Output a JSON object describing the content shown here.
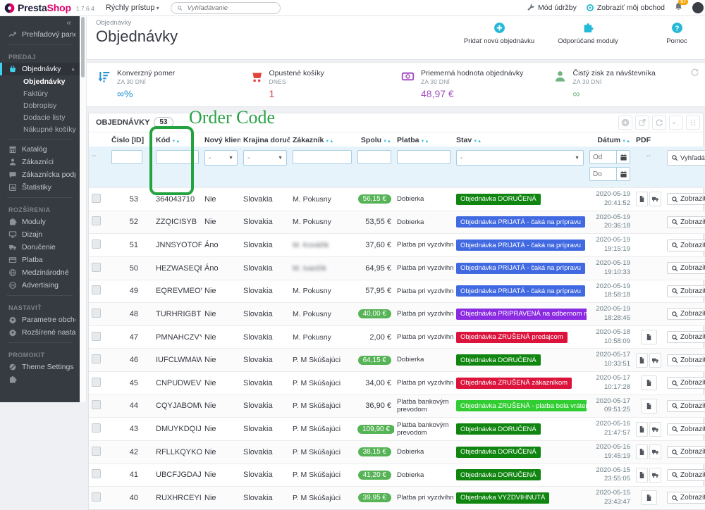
{
  "accent_color": "#25b9d7",
  "topbar": {
    "brand_presta": "Presta",
    "brand_shop": "Shop",
    "version": "1.7.6.4",
    "quick_access": "Rýchly prístup",
    "search_placeholder": "Vyhľadávanie",
    "maintenance_label": "Mód údržby",
    "view_shop_label": "Zobraziť môj obchod",
    "notifications_count": "57"
  },
  "sidebar": {
    "collapse_glyph": "«",
    "sections": [
      {
        "header": "",
        "items": [
          {
            "icon": "trend",
            "label": "Prehľadový panel"
          }
        ]
      },
      {
        "header": "PREDAJ",
        "items": [
          {
            "icon": "basket",
            "label": "Objednávky",
            "active": true,
            "expanded": true,
            "submenu": [
              {
                "label": "Objednávky",
                "active": true
              },
              {
                "label": "Faktúry"
              },
              {
                "label": "Dobropisy"
              },
              {
                "label": "Dodacie listy"
              },
              {
                "label": "Nákupné košíky"
              }
            ]
          },
          {
            "icon": "store",
            "label": "Katalóg"
          },
          {
            "icon": "person",
            "label": "Zákazníci"
          },
          {
            "icon": "chat",
            "label": "Zákaznícka podpora"
          },
          {
            "icon": "stats",
            "label": "Štatistiky"
          }
        ]
      },
      {
        "header": "ROZŠÍRENIA",
        "items": [
          {
            "icon": "puzzle",
            "label": "Moduly"
          },
          {
            "icon": "monitor",
            "label": "Dizajn"
          },
          {
            "icon": "truck",
            "label": "Doručenie"
          },
          {
            "icon": "card",
            "label": "Platba"
          },
          {
            "icon": "globe",
            "label": "Medzinárodné"
          },
          {
            "icon": "ball",
            "label": "Advertising"
          }
        ]
      },
      {
        "header": "NASTAVIŤ",
        "items": [
          {
            "icon": "gear",
            "label": "Parametre obchodu"
          },
          {
            "icon": "gear",
            "label": "Rozšírené nastavenia"
          }
        ]
      },
      {
        "header": "PROMOKIT",
        "items": [
          {
            "icon": "theme",
            "label": "Theme Settings"
          },
          {
            "icon": "puzzle",
            "label": ""
          }
        ]
      }
    ]
  },
  "header": {
    "breadcrumb": "Objednávky",
    "title": "Objednávky",
    "actions": [
      {
        "icon": "plus-circle",
        "label": "Pridať novú objednávku"
      },
      {
        "icon": "puzzle-blue",
        "label": "Odporúčané moduly"
      },
      {
        "icon": "question-circle",
        "label": "Pomoc"
      }
    ]
  },
  "kpis": [
    {
      "icon": "funnel",
      "icon_color": "#2592d0",
      "label": "Konverzný pomer",
      "sublabel": "ZA 30 DNÍ",
      "value": "∞%",
      "value_color": "#2592d0"
    },
    {
      "icon": "cart",
      "icon_color": "#e0433b",
      "label": "Opustené košíky",
      "sublabel": "DNES",
      "value": "1",
      "value_color": "#e0433b"
    },
    {
      "icon": "banknote",
      "icon_color": "#a34fc3",
      "label": "Priemerná hodnota objednávky",
      "sublabel": "ZA 30 DNÍ",
      "value": "48,97 €",
      "value_color": "#a34fc3"
    },
    {
      "icon": "person",
      "icon_color": "#70b580",
      "label": "Čistý zisk za návštevníka",
      "sublabel": "ZA 30 DNÍ",
      "value": "∞",
      "value_color": "#70b580"
    }
  ],
  "panel": {
    "title": "OBJEDNÁVKY",
    "count": "53",
    "tools": [
      "plus-circle",
      "export",
      "refresh",
      "terminal",
      "grid"
    ]
  },
  "table": {
    "columns": [
      {
        "key": "check",
        "label": "",
        "sortable": false
      },
      {
        "key": "id",
        "label": "Čislo [ID]",
        "sortable": true,
        "align": "right"
      },
      {
        "key": "code",
        "label": "Kód",
        "sortable": true
      },
      {
        "key": "new_client",
        "label": "Nový klient",
        "sortable": false
      },
      {
        "key": "country",
        "label": "Krajina doručenia",
        "sortable": true
      },
      {
        "key": "customer",
        "label": "Zákazník",
        "sortable": true
      },
      {
        "key": "total",
        "label": "Spolu",
        "sortable": true,
        "align": "right"
      },
      {
        "key": "payment",
        "label": "Platba",
        "sortable": true
      },
      {
        "key": "status",
        "label": "Stav",
        "sortable": true
      },
      {
        "key": "date",
        "label": "Dátum",
        "sortable": true,
        "align": "right"
      },
      {
        "key": "pdf",
        "label": "PDF",
        "sortable": false
      },
      {
        "key": "actions",
        "label": "",
        "sortable": false
      }
    ],
    "filters": {
      "dash": "--",
      "select_value": "-",
      "date_from_placeholder": "Od",
      "date_to_placeholder": "Do",
      "search_label": "Vyhľadávanie"
    },
    "row_action_label": "Zobraziť",
    "rows": [
      {
        "id": "53",
        "code": "364043710",
        "new_client": "Nie",
        "country": "Slovakia",
        "customer": "M. Pokusny",
        "total": "56,15 €",
        "total_pill": true,
        "payment": "Dobierka",
        "status": "Objednávka DORUČENÁ",
        "status_color": "#108510",
        "date": "2020-05-19",
        "time": "20:41:52",
        "pdf": [
          "invoice",
          "delivery"
        ]
      },
      {
        "id": "52",
        "code": "ZZQICISYB",
        "new_client": "Nie",
        "country": "Slovakia",
        "customer": "M. Pokusny",
        "total": "53,55 €",
        "total_pill": false,
        "payment": "Dobierka",
        "status": "Objednávka PRIJATÁ - čaká na prípravu",
        "status_color": "#4169e1",
        "date": "2020-05-19",
        "time": "20:36:18",
        "pdf": []
      },
      {
        "id": "51",
        "code": "JNNSYOTOF",
        "new_client": "Áno",
        "country": "Slovakia",
        "customer": "M. Kováčik",
        "customer_blurred": true,
        "total": "37,60 €",
        "total_pill": false,
        "payment": "Platba pri vyzdvihnutí",
        "status": "Objednávka PRIJATÁ - čaká na prípravu",
        "status_color": "#4169e1",
        "date": "2020-05-19",
        "time": "19:15:19",
        "pdf": []
      },
      {
        "id": "50",
        "code": "HEZWASEQB",
        "new_client": "Áno",
        "country": "Slovakia",
        "customer": "M. Ivančík",
        "customer_blurred": true,
        "total": "64,95 €",
        "total_pill": false,
        "payment": "Platba pri vyzdvihnutí",
        "status": "Objednávka PRIJATÁ - čaká na prípravu",
        "status_color": "#4169e1",
        "date": "2020-05-19",
        "time": "19:10:33",
        "pdf": []
      },
      {
        "id": "49",
        "code": "EQREVMEOW",
        "new_client": "Nie",
        "country": "Slovakia",
        "customer": "M. Pokusny",
        "total": "57,95 €",
        "total_pill": false,
        "payment": "Platba pri vyzdvihnutí",
        "status": "Objednávka PRIJATÁ - čaká na prípravu",
        "status_color": "#4169e1",
        "date": "2020-05-19",
        "time": "18:58:18",
        "pdf": []
      },
      {
        "id": "48",
        "code": "TURHRIGBT",
        "new_client": "Nie",
        "country": "Slovakia",
        "customer": "M. Pokusny",
        "total": "40,00 €",
        "total_pill": true,
        "payment": "Platba pri vyzdvihnutí",
        "status": "Objednávka PRIPRAVENÁ na odbernom mieste",
        "status_color": "#8a2be2",
        "date": "2020-05-19",
        "time": "18:28:45",
        "pdf": []
      },
      {
        "id": "47",
        "code": "PMNAHCZVY",
        "new_client": "Nie",
        "country": "Slovakia",
        "customer": "M. Pokusny",
        "total": "2,00 €",
        "total_pill": false,
        "payment": "Platba pri vyzdvihnutí",
        "status": "Objednávka ZRUŠENÁ predajcom",
        "status_color": "#dc143c",
        "date": "2020-05-18",
        "time": "10:58:09",
        "pdf": [
          "invoice"
        ]
      },
      {
        "id": "46",
        "code": "IUFCLWMAW",
        "new_client": "Nie",
        "country": "Slovakia",
        "customer": "P. M Skúšajúci",
        "total": "64,15 €",
        "total_pill": true,
        "payment": "Dobierka",
        "status": "Objednávka DORUČENÁ",
        "status_color": "#108510",
        "date": "2020-05-17",
        "time": "10:33:51",
        "pdf": [
          "invoice",
          "delivery"
        ]
      },
      {
        "id": "45",
        "code": "CNPUDWEVY",
        "new_client": "Nie",
        "country": "Slovakia",
        "customer": "P. M Skúšajúci",
        "total": "34,00 €",
        "total_pill": false,
        "payment": "Platba pri vyzdvihnutí",
        "status": "Objednávka ZRUŠENÁ zákazníkom",
        "status_color": "#dc143c",
        "date": "2020-05-17",
        "time": "10:17:28",
        "pdf": [
          "invoice"
        ]
      },
      {
        "id": "44",
        "code": "CQYJABOMW",
        "new_client": "Nie",
        "country": "Slovakia",
        "customer": "P. M Skúšajúci",
        "total": "36,90 €",
        "total_pill": false,
        "payment": "Platba bankovým prevodom",
        "status": "Objednávka ZRUŠENÁ - platba bola vrátená",
        "status_color": "#32cd32",
        "date": "2020-05-17",
        "time": "09:51:25",
        "pdf": [
          "invoice"
        ]
      },
      {
        "id": "43",
        "code": "DMUYKDQIJ",
        "new_client": "Nie",
        "country": "Slovakia",
        "customer": "P. M Skúšajúci",
        "total": "109,90 €",
        "total_pill": true,
        "payment": "Platba bankovým prevodom",
        "status": "Objednávka DORUČENÁ",
        "status_color": "#108510",
        "date": "2020-05-16",
        "time": "21:47:57",
        "pdf": [
          "invoice",
          "delivery"
        ]
      },
      {
        "id": "42",
        "code": "RFLLKQYKO",
        "new_client": "Nie",
        "country": "Slovakia",
        "customer": "P. M Skúšajúci",
        "total": "38,15 €",
        "total_pill": true,
        "payment": "Dobierka",
        "status": "Objednávka DORUČENÁ",
        "status_color": "#108510",
        "date": "2020-05-16",
        "time": "19:45:19",
        "pdf": [
          "invoice",
          "delivery"
        ]
      },
      {
        "id": "41",
        "code": "UBCFJGDAJ",
        "new_client": "Nie",
        "country": "Slovakia",
        "customer": "P. M Skúšajúci",
        "total": "41,20 €",
        "total_pill": true,
        "payment": "Dobierka",
        "status": "Objednávka DORUČENÁ",
        "status_color": "#108510",
        "date": "2020-05-15",
        "time": "23:55:05",
        "pdf": [
          "invoice",
          "delivery"
        ]
      },
      {
        "id": "40",
        "code": "RUXHRCEYI",
        "new_client": "Nie",
        "country": "Slovakia",
        "customer": "P. M Skúšajúci",
        "total": "39,95 €",
        "total_pill": true,
        "payment": "Platba pri vyzdvihnutí",
        "status": "Objednávka VYZDVIHNUTÁ",
        "status_color": "#108510",
        "date": "2020-05-15",
        "time": "23:43:47",
        "pdf": [
          "invoice"
        ]
      }
    ]
  },
  "annotation": {
    "text": "Order Code",
    "color": "#2aa146"
  }
}
